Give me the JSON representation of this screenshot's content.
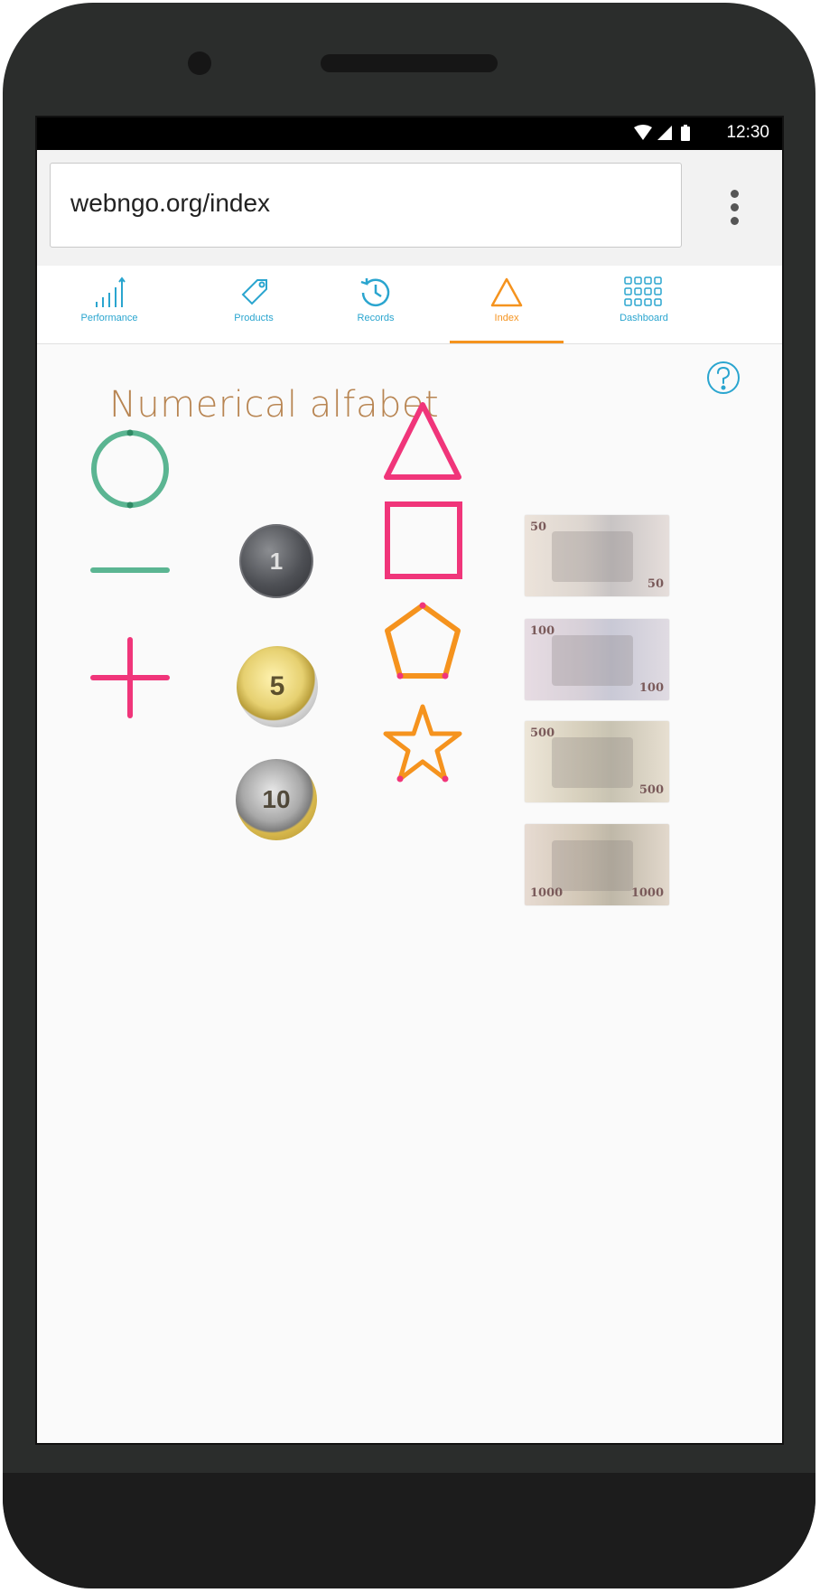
{
  "status": {
    "time": "12:30"
  },
  "browser": {
    "url": "webngo.org/index"
  },
  "tabs": [
    {
      "label": "Performance",
      "icon": "signal-bars-icon"
    },
    {
      "label": "Products",
      "icon": "tag-icon"
    },
    {
      "label": "Records",
      "icon": "history-icon"
    },
    {
      "label": "Index",
      "icon": "triangle-icon",
      "active": true
    },
    {
      "label": "Dashboard",
      "icon": "grid-icon"
    }
  ],
  "main": {
    "title": "Numerical alfabet",
    "coins": [
      {
        "value": "1",
        "shape": "circle-icon"
      },
      {
        "value": "5",
        "shape": "minus-icon"
      },
      {
        "value": "10",
        "shape": "plus-icon"
      }
    ],
    "notes": [
      {
        "value": "50",
        "shape": "triangle-icon"
      },
      {
        "value": "100",
        "shape": "square-icon"
      },
      {
        "value": "500",
        "shape": "pentagon-icon"
      },
      {
        "value": "1000",
        "shape": "star-icon"
      }
    ]
  },
  "colors": {
    "accent": "#2aa5cf",
    "active": "#f5931e",
    "green": "#5bb592",
    "pink": "#f0357a",
    "orange": "#f5931e",
    "title": "#b88552"
  }
}
